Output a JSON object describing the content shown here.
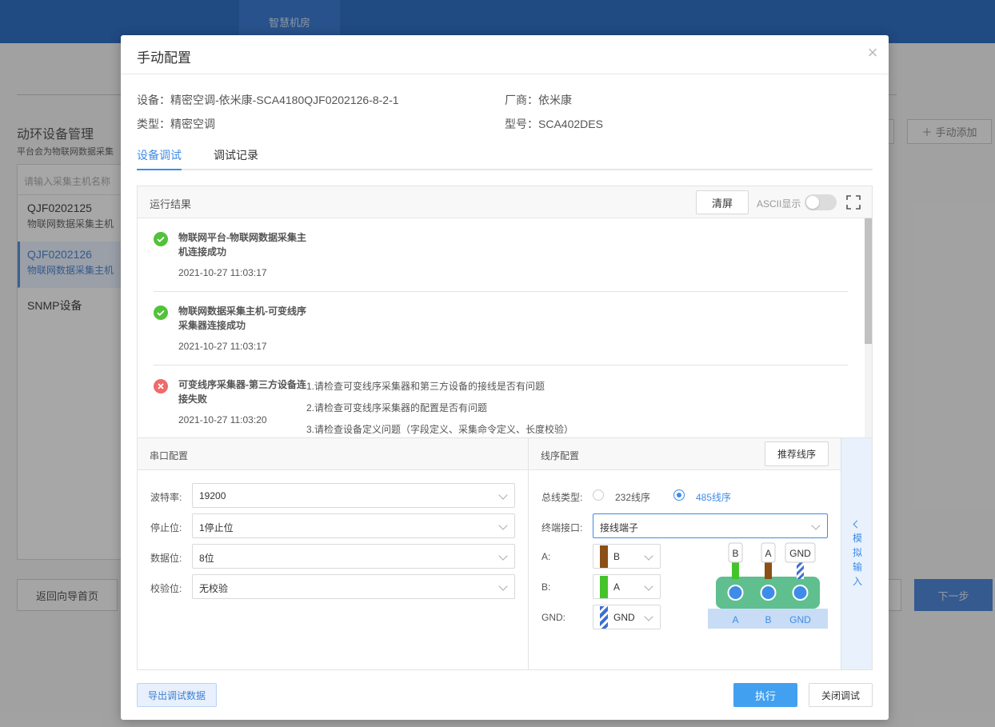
{
  "background": {
    "top_tab": "智慧机房",
    "section_title": "动环设备管理",
    "section_sub": "平台会为物联网数据采集",
    "search_placeholder": "请输入采集主机名称",
    "list": [
      {
        "name": "QJF0202125",
        "desc": "物联网数据采集主机"
      },
      {
        "name": "QJF0202126",
        "desc": "物联网数据采集主机"
      },
      {
        "name": "SNMP设备",
        "desc": ""
      }
    ],
    "back_button": "返回向导首页",
    "next_button": "下一步",
    "add_button": "手动添加"
  },
  "modal": {
    "title": "手动配置",
    "device_label": "设备：",
    "device_value": "精密空调-依米康-SCA4180QJF0202126-8-2-1",
    "vendor_label": "厂商：",
    "vendor_value": "依米康",
    "type_label": "类型：",
    "type_value": "精密空调",
    "model_label": "型号：",
    "model_value": "SCA402DES",
    "tabs": [
      "设备调试",
      "调试记录"
    ],
    "result": {
      "title": "运行结果",
      "clear_button": "清屏",
      "ascii_label": "ASCII显示",
      "items": [
        {
          "status": "success",
          "title": "物联网平台-物联网数据采集主机连接成功",
          "time": "2021-10-27 11:03:17"
        },
        {
          "status": "success",
          "title": "物联网数据采集主机-可变线序采集器连接成功",
          "time": "2021-10-27 11:03:17"
        },
        {
          "status": "error",
          "title": "可变线序采集器-第三方设备连接失败",
          "time": "2021-10-27 11:03:20",
          "hints": [
            "1.请检查可变线序采集器和第三方设备的接线是否有问题",
            "2.请检查可变线序采集器的配置是否有问题",
            "3.请检查设备定义问题（字段定义、采集命令定义、长度校验）"
          ]
        }
      ]
    },
    "serial": {
      "title": "串口配置",
      "baud_label": "波特率:",
      "baud_value": "19200",
      "stop_label": "停止位:",
      "stop_value": "1停止位",
      "data_label": "数据位:",
      "data_value": "8位",
      "parity_label": "校验位:",
      "parity_value": "无校验"
    },
    "wiring": {
      "title": "线序配置",
      "recommend_button": "推荐线序",
      "bus_label": "总线类型:",
      "bus_options": [
        "232线序",
        "485线序"
      ],
      "terminal_label": "终端接口:",
      "terminal_value": "接线端子",
      "a_label": "A:",
      "a_value": "B",
      "b_label": "B:",
      "b_value": "A",
      "gnd_label": "GND:",
      "gnd_value": "GND",
      "diagram_top": [
        "B",
        "A",
        "GND"
      ],
      "diagram_bottom": [
        "A",
        "B",
        "GND"
      ]
    },
    "sim_input": "模拟输入",
    "export_button": "导出调试数据",
    "run_button": "执行",
    "close_button": "关闭调试"
  },
  "colors": {
    "accent": "#3f8ce8",
    "success": "#52c23a",
    "error": "#f06a6a",
    "wire_brown": "#8b4f17",
    "wire_green": "#44c42a",
    "wire_blue": "#3d6fd0",
    "terminal_green": "#5fbf8f"
  }
}
